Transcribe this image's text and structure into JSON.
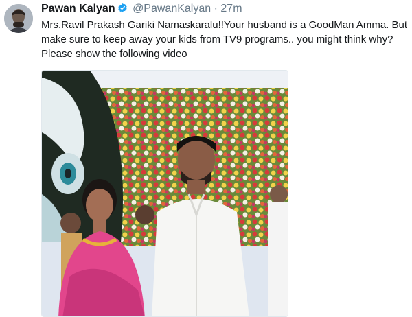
{
  "tweet": {
    "display_name": "Pawan Kalyan",
    "handle": "@PawanKalyan",
    "separator": "·",
    "timestamp": "27m",
    "lines": [
      "Mrs.Ravil Prakash Gariki Namaskaralu!!Your husband is a GoodMan Amma. But",
      "make sure to keep away your kids from TV9 programs.. you might think why?",
      "Please show the following video"
    ],
    "verified": true
  },
  "colors": {
    "verified_badge": "#1da1f2",
    "name": "#14171a",
    "meta": "#657786"
  }
}
